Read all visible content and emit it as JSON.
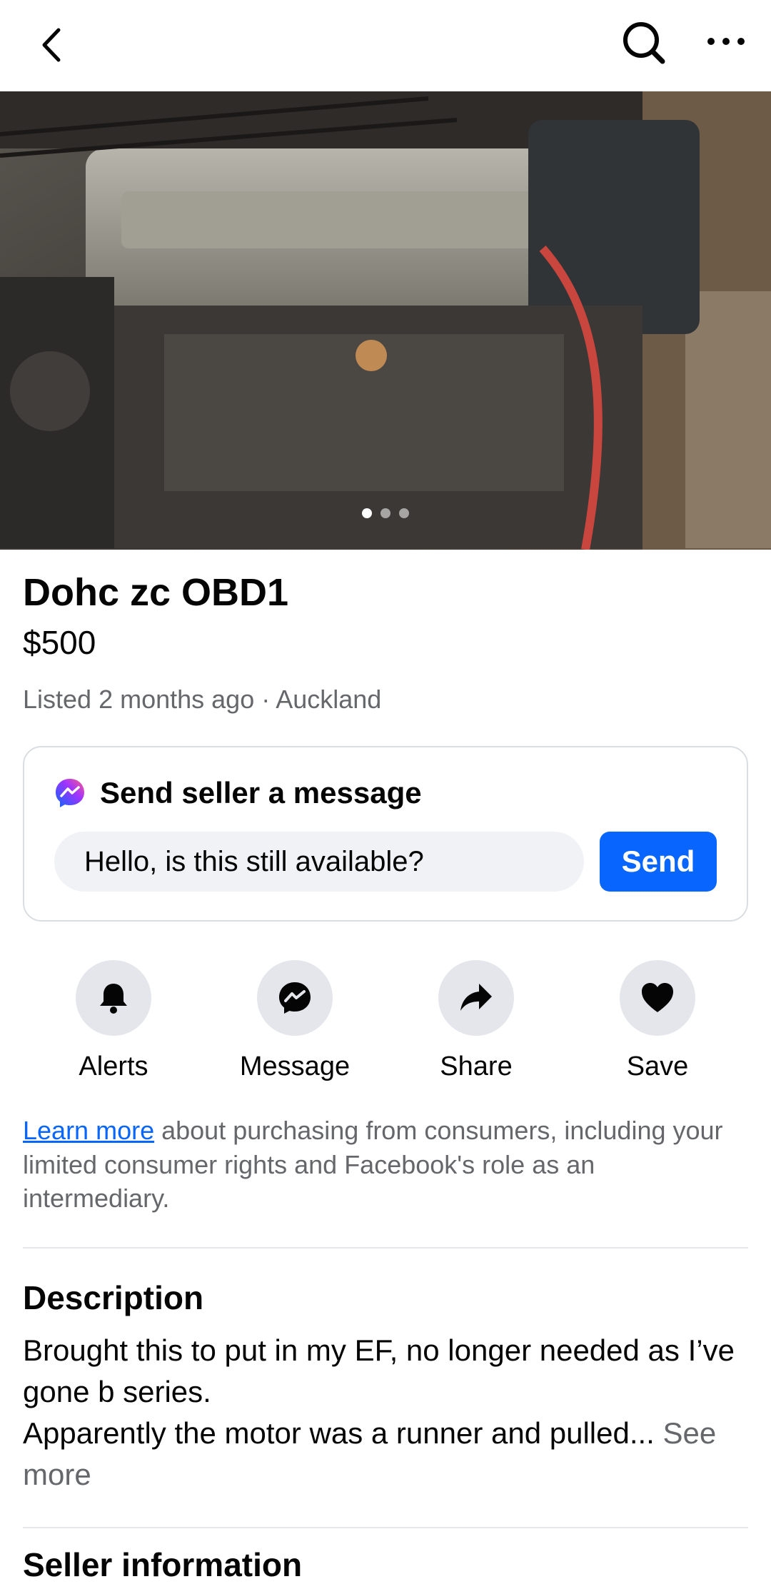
{
  "topbar": {
    "back": "back-icon",
    "search": "search-icon",
    "more": "more-icon"
  },
  "hero": {
    "image_alt": "engine",
    "page_count": 3,
    "active_page": 1
  },
  "listing": {
    "title": "Dohc zc OBD1",
    "price": "$500",
    "meta": "Listed 2 months ago · Auckland"
  },
  "message": {
    "header": "Send seller a message",
    "input_value": "Hello, is this still available?",
    "send_label": "Send"
  },
  "actions": [
    {
      "label": "Alerts",
      "icon": "bell-icon"
    },
    {
      "label": "Message",
      "icon": "messenger-icon"
    },
    {
      "label": "Share",
      "icon": "share-icon"
    },
    {
      "label": "Save",
      "icon": "heart-icon"
    }
  ],
  "notice": {
    "link": "Learn more",
    "text": " about purchasing from consumers, including your limited consumer rights and Facebook's role as an intermediary."
  },
  "description": {
    "heading": "Description",
    "line1": "Brought this to put in my EF, no longer needed as I’ve gone b series.",
    "line2": "Apparently the motor was a runner and pulled... ",
    "see_more": "See more"
  },
  "seller_heading": "Seller information",
  "colors": {
    "accent": "#0866ff",
    "secondary_text": "#65676b",
    "chip_bg": "#e4e6eb"
  }
}
